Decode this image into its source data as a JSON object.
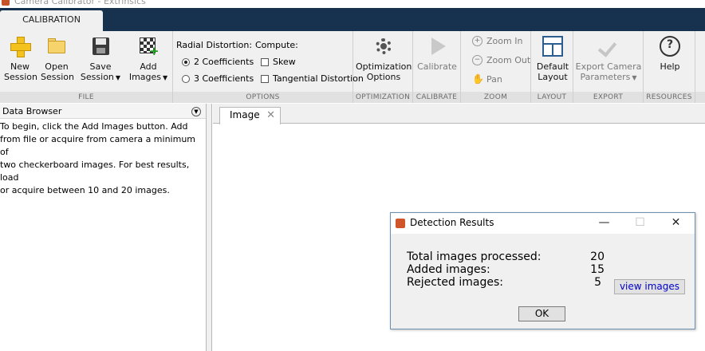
{
  "window": {
    "title": "Camera Calibrator - Extrinsics"
  },
  "ribbon_tabs": [
    {
      "label": "CALIBRATION"
    }
  ],
  "ribbon": {
    "file": {
      "label": "FILE",
      "new_line1": "New",
      "new_line2": "Session",
      "open_line1": "Open",
      "open_line2": "Session",
      "save_line1": "Save",
      "save_line2": "Session",
      "add_line1": "Add",
      "add_line2": "Images"
    },
    "options": {
      "label": "OPTIONS",
      "radial_title": "Radial Distortion:",
      "compute_title": "Compute:",
      "coeff2": "2 Coefficients",
      "coeff3": "3 Coefficients",
      "skew": "Skew",
      "tangential": "Tangential Distortion",
      "selected_radial": "2 Coefficients"
    },
    "optimization": {
      "label": "OPTIMIZATION",
      "btn_line1": "Optimization",
      "btn_line2": "Options"
    },
    "calibrate": {
      "label": "CALIBRATE",
      "btn": "Calibrate"
    },
    "zoom": {
      "label": "ZOOM",
      "zoom_in": "Zoom In",
      "zoom_out": "Zoom Out",
      "pan": "Pan"
    },
    "layout": {
      "label": "LAYOUT",
      "btn_line1": "Default",
      "btn_line2": "Layout"
    },
    "export": {
      "label": "EXPORT",
      "btn_line1": "Export Camera",
      "btn_line2": "Parameters"
    },
    "resources": {
      "label": "RESOURCES",
      "help": "Help"
    }
  },
  "data_browser": {
    "title": "Data Browser",
    "instructions": "To begin, click the Add Images button. Add\nfrom file or acquire from camera a minimum of\ntwo checkerboard images. For best results, load\nor acquire between 10 and 20 images."
  },
  "document_tabs": [
    {
      "label": "Image"
    }
  ],
  "dialog": {
    "title": "Detection Results",
    "total_label": "Total images processed:",
    "total_value": "20",
    "added_label": "Added images:",
    "added_value": "15",
    "rejected_label": "Rejected images:",
    "rejected_value": "5",
    "view_images": "view images",
    "ok": "OK",
    "minimize": "—",
    "maximize": "☐",
    "close": "✕"
  },
  "icons": {
    "new": "plus-icon",
    "open": "folder-icon",
    "save": "floppy-disk-icon",
    "add": "checkerboard-add-icon",
    "optimization": "gear-icon",
    "calibrate": "play-icon",
    "zoom_in": "zoom-in-icon",
    "zoom_out": "zoom-out-icon",
    "pan": "hand-icon",
    "layout": "layout-icon",
    "export": "checkmark-icon",
    "help": "help-icon"
  },
  "colors": {
    "tabstrip": "#16324f",
    "ribbon": "#f0f0f0",
    "link": "#0000cc"
  }
}
